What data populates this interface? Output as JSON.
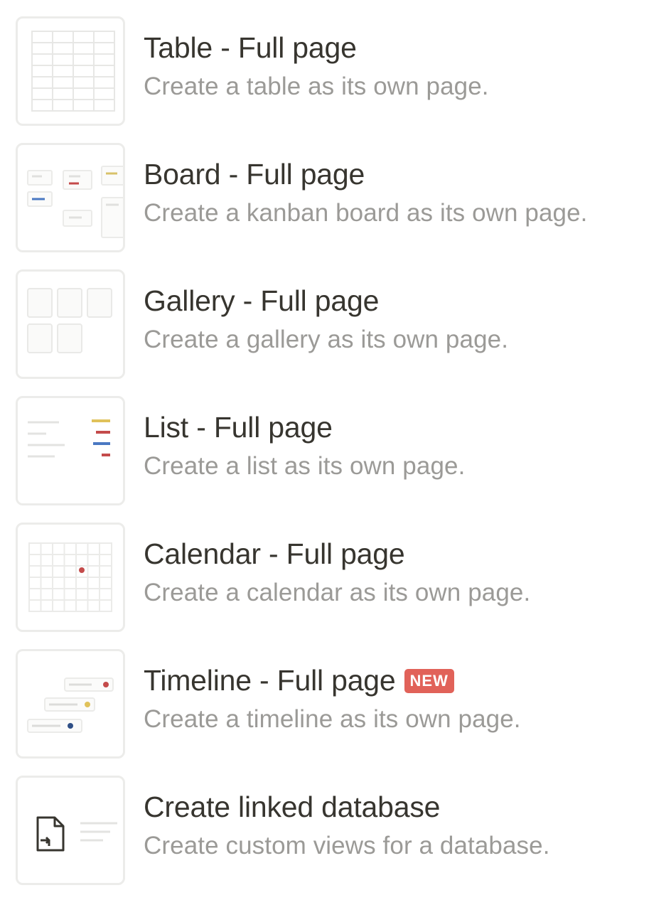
{
  "menu": {
    "items": [
      {
        "icon": "table-icon",
        "title": "Table - Full page",
        "desc": "Create a table as its own page."
      },
      {
        "icon": "board-icon",
        "title": "Board - Full page",
        "desc": "Create a kanban board as its own page."
      },
      {
        "icon": "gallery-icon",
        "title": "Gallery - Full page",
        "desc": "Create a gallery as its own page."
      },
      {
        "icon": "list-icon",
        "title": "List - Full page",
        "desc": "Create a list as its own page."
      },
      {
        "icon": "calendar-icon",
        "title": "Calendar - Full page",
        "desc": "Create a calendar as its own page."
      },
      {
        "icon": "timeline-icon",
        "title": "Timeline - Full page",
        "desc": "Create a timeline as its own page.",
        "badge": "NEW"
      },
      {
        "icon": "linked-database-icon",
        "title": "Create linked database",
        "desc": "Create custom views for a database."
      }
    ]
  },
  "colors": {
    "title": "#37352f",
    "description": "#9b9a97",
    "badge": "#e16259",
    "thumb_border": "#ececea"
  }
}
